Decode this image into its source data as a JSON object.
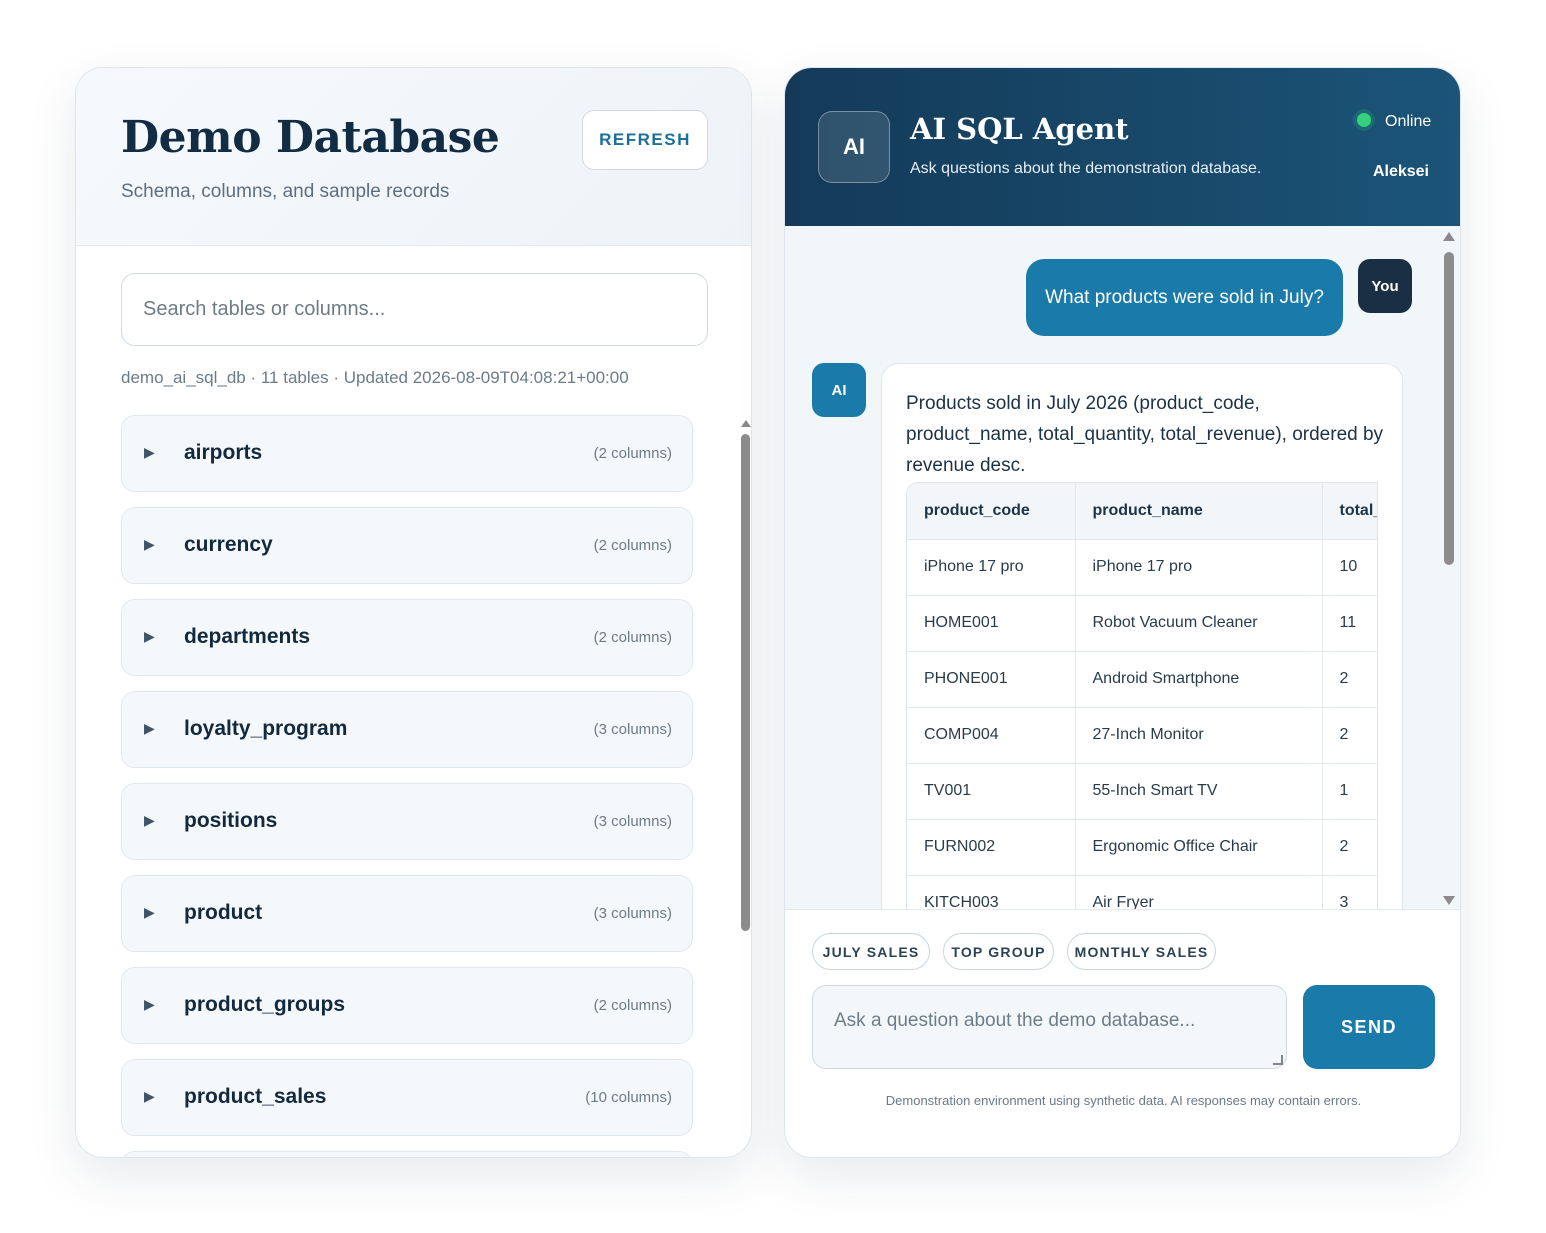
{
  "left_panel": {
    "title": "Demo Database",
    "subtitle": "Schema, columns, and sample records",
    "refresh_label": "REFRESH",
    "search_placeholder": "Search tables or columns...",
    "meta": "demo_ai_sql_db · 11 tables · Updated 2026-08-09T04:08:21+00:00",
    "caret_glyph": "▶",
    "tables": [
      {
        "name": "airports",
        "columns": "(2 columns)"
      },
      {
        "name": "currency",
        "columns": "(2 columns)"
      },
      {
        "name": "departments",
        "columns": "(2 columns)"
      },
      {
        "name": "loyalty_program",
        "columns": "(3 columns)"
      },
      {
        "name": "positions",
        "columns": "(3 columns)"
      },
      {
        "name": "product",
        "columns": "(3 columns)"
      },
      {
        "name": "product_groups",
        "columns": "(2 columns)"
      },
      {
        "name": "product_sales",
        "columns": "(10 columns)"
      }
    ]
  },
  "chat": {
    "avatar_label": "AI",
    "title": "AI SQL Agent",
    "subtitle": "Ask questions about the demonstration database.",
    "status": "Online",
    "user_name": "Aleksei",
    "accent_color": "#1a7aaa",
    "status_color": "#34d07a",
    "user_message": "What products were sold in July?",
    "you_label": "You",
    "ai_label": "AI",
    "ai_message": "Products sold in July 2026 (product_code, product_name, total_quantity, total_revenue), ordered by revenue desc.",
    "result_table": {
      "headers": [
        "product_code",
        "product_name",
        "total_quantity"
      ],
      "rows": [
        [
          "iPhone 17 pro",
          "iPhone 17 pro",
          "10"
        ],
        [
          "HOME001",
          "Robot Vacuum Cleaner",
          "11"
        ],
        [
          "PHONE001",
          "Android Smartphone",
          "2"
        ],
        [
          "COMP004",
          "27-Inch Monitor",
          "2"
        ],
        [
          "TV001",
          "55-Inch Smart TV",
          "1"
        ],
        [
          "FURN002",
          "Ergonomic Office Chair",
          "2"
        ],
        [
          "KITCH003",
          "Air Fryer",
          "3"
        ]
      ]
    },
    "chips": [
      "JULY SALES",
      "TOP GROUP",
      "MONTHLY SALES"
    ],
    "input_placeholder": "Ask a question about the demo database...",
    "send_label": "SEND",
    "disclaimer": "Demonstration environment using synthetic data. AI responses may contain errors."
  }
}
